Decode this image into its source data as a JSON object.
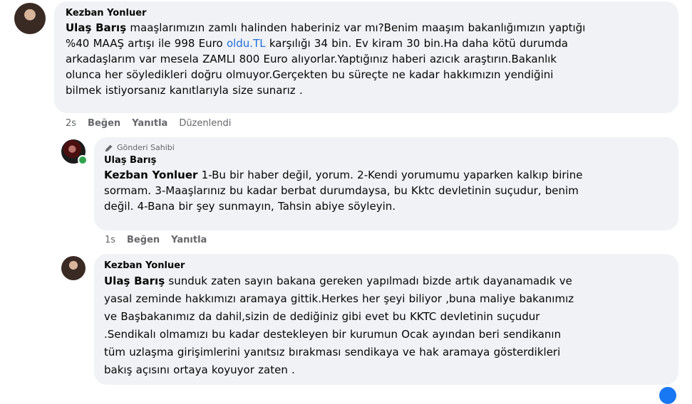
{
  "comments": [
    {
      "author": "Kezban Yonluer",
      "badge": "",
      "mention": "Ulaş Barış",
      "lines": [
        {
          "pre": " maaşlarımızın zamlı halinden haberiniz var mı?Benim maaşım bakanlığımızın yaptığı",
          "link": "",
          "post": ""
        },
        {
          "pre": "%40 MAAŞ artışı ile 998 Euro ",
          "link": "oldu.TL",
          "post": " karşılığı 34 bin. Ev kiram 30 bin.Ha daha kötü durumda"
        },
        {
          "pre": "arkadaşlarım var mesela ZAMLI 800 Euro alıyorlar.Yaptığınız haberi azıcık araştırın.Bakanlık",
          "link": "",
          "post": ""
        },
        {
          "pre": "olunca her söyledikleri doğru olmuyor.Gerçekten bu süreçte ne kadar hakkımızın yendiğini",
          "link": "",
          "post": ""
        },
        {
          "pre": "bilmek istiyorsanız kanıtlarıyla size sunarız .",
          "link": "",
          "post": ""
        }
      ],
      "time": "2s",
      "like": "Beğen",
      "reply": "Yanıtla",
      "edited": "Düzenlendi"
    },
    {
      "author": "Ulaş Barış",
      "badge": "Gönderi Sahibi",
      "mention": "Kezban Yonluer",
      "lines": [
        {
          "pre": " 1-Bu bir haber değil, yorum. 2-Kendi yorumumu yaparken kalkıp birine",
          "link": "",
          "post": ""
        },
        {
          "pre": "sormam. 3-Maaşlarınız bu kadar berbat durumdaysa, bu Kktc devletinin suçudur, benim",
          "link": "",
          "post": ""
        },
        {
          "pre": "değil. 4-Bana bir şey sunmayın, Tahsin abiye söyleyin.",
          "link": "",
          "post": ""
        }
      ],
      "time": "1s",
      "like": "Beğen",
      "reply": "Yanıtla",
      "edited": ""
    },
    {
      "author": "Kezban Yonluer",
      "badge": "",
      "mention": "Ulaş Barış",
      "lines": [
        {
          "pre": " sunduk zaten sayın bakana gereken yapılmadı bizde artık dayanamadık ve",
          "link": "",
          "post": ""
        },
        {
          "pre": "yasal zeminde hakkımızı aramaya gittik.Herkes her şeyi biliyor ,buna maliye bakanımız",
          "link": "",
          "post": ""
        },
        {
          "pre": "ve Başbakanımız da dahil,sizin de dediğiniz gibi evet bu KKTC devletinin suçudur",
          "link": "",
          "post": ""
        },
        {
          "pre": ".Sendikalı olmamızı bu kadar destekleyen bir kurumun Ocak ayından beri sendikanın",
          "link": "",
          "post": ""
        },
        {
          "pre": "tüm uzlaşma girişimlerini yanıtsız bırakması sendikaya ve hak aramaya gösterdikleri",
          "link": "",
          "post": ""
        },
        {
          "pre": "bakış açısını ortaya koyuyor zaten .",
          "link": "",
          "post": ""
        }
      ],
      "time": "",
      "like": "",
      "reply": "",
      "edited": ""
    }
  ]
}
